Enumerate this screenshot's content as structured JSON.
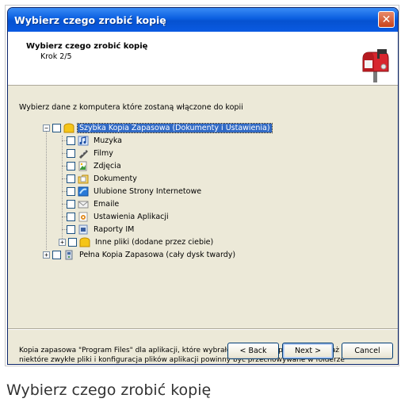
{
  "window": {
    "title": "Wybierz czego zrobić kopię"
  },
  "header": {
    "title": "Wybierz czego zrobić kopię",
    "step": "Krok 2/5"
  },
  "instruction": "Wybierz dane z komputera które zostaną włączone do kopii",
  "tree": {
    "quick_backup": {
      "label": "Szybka Kopia Zapasowa (Dokumenty i Ustawienia)",
      "expander": "−",
      "icon": "folder-icon"
    },
    "children": [
      {
        "label": "Muzyka",
        "icon": "music-icon"
      },
      {
        "label": "Filmy",
        "icon": "film-icon"
      },
      {
        "label": "Zdjęcia",
        "icon": "picture-icon"
      },
      {
        "label": "Dokumenty",
        "icon": "documents-folder-icon"
      },
      {
        "label": "Ulubione Strony Internetowe",
        "icon": "internet-favorites-icon"
      },
      {
        "label": "Emaile",
        "icon": "email-icon"
      },
      {
        "label": "Ustawienia Aplikacji",
        "icon": "app-settings-icon"
      },
      {
        "label": "Raporty IM",
        "icon": "im-report-icon"
      }
    ],
    "other_files": {
      "label": "Inne pliki (dodane przez ciebie)",
      "expander": "+",
      "icon": "folder-icon"
    },
    "full_backup": {
      "label": "Pełna Kopia Zapasowa (cały dysk twardy)",
      "expander": "+",
      "icon": "hard-drive-icon"
    }
  },
  "note": "Kopia zapasowa \"Program Files\" dla aplikacji, które wybrałeś jest niekompletna, ponieważ niektóre zwykłe pliki i konfiguracja plików aplikacji powinny być przechowywane w folderze systemowym.",
  "buttons": {
    "back": "< Back",
    "next": "Next >",
    "cancel": "Cancel"
  },
  "caption": "Wybierz czego zrobić kopię",
  "colors": {
    "titlebar": "#0a5ee0",
    "selection": "#316ac5",
    "dialog_bg": "#ece9d8"
  }
}
